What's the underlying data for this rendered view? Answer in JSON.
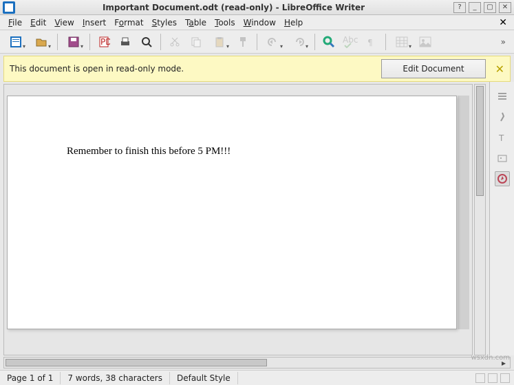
{
  "titlebar": {
    "title": "Important Document.odt (read-only) - LibreOffice Writer",
    "app_icon": "libreoffice-writer-icon"
  },
  "window_buttons": {
    "help": "?",
    "min": "_",
    "max": "▢",
    "close": "✕"
  },
  "menubar": {
    "file": "File",
    "edit": "Edit",
    "view": "View",
    "insert": "Insert",
    "format": "Format",
    "styles": "Styles",
    "table": "Table",
    "tools": "Tools",
    "window": "Window",
    "help": "Help",
    "close_doc": "✕"
  },
  "toolbar": {
    "new": "new",
    "open": "open",
    "recent": "recent",
    "pdf": "pdf-export",
    "print": "print",
    "preview": "print-preview",
    "cut": "cut",
    "copy": "copy",
    "paste": "paste",
    "brush": "clone-formatting",
    "undo": "undo",
    "redo": "redo",
    "find": "find-and-replace",
    "spell": "spell-check",
    "pilcrow": "formatting-marks",
    "table": "insert-table",
    "image": "insert-image"
  },
  "infobar": {
    "text": "This document is open in read-only mode.",
    "button": "Edit Document",
    "close": "✕"
  },
  "document": {
    "content": "Remember to finish this before 5 PM!!!"
  },
  "sidepanel": {
    "properties": "properties",
    "styles": "styles",
    "textbox": "textbox",
    "gallery": "gallery",
    "navigator": "navigator"
  },
  "statusbar": {
    "page": "Page 1 of 1",
    "words": "7 words, 38 characters",
    "style": "Default Style"
  },
  "watermark": "wsxdn.com"
}
